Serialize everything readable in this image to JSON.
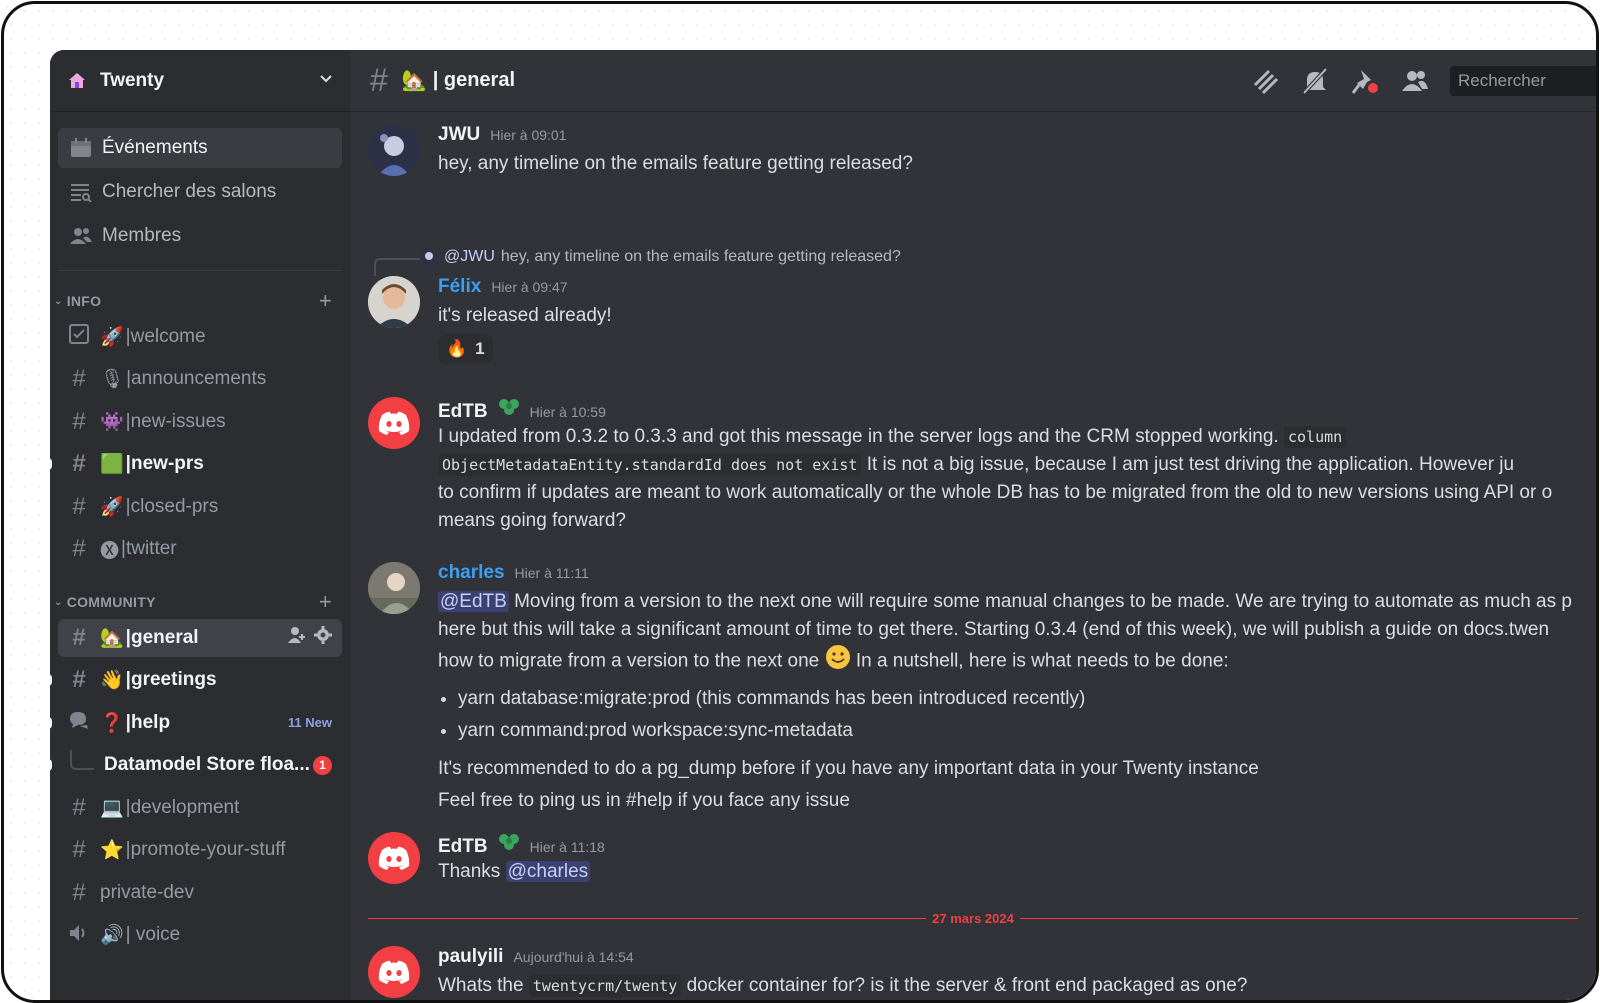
{
  "server": {
    "name": "Twenty"
  },
  "nav": {
    "events": "Événements",
    "browse": "Chercher des salons",
    "members": "Membres"
  },
  "categories": {
    "info": "INFO",
    "community": "COMMUNITY"
  },
  "info_channels": [
    {
      "emoji": "🚀",
      "name": "|welcome"
    },
    {
      "emoji": "🎙",
      "name": "|announcements"
    },
    {
      "emoji": "👾",
      "name": "|new-issues"
    },
    {
      "emoji": "🟩",
      "name": "|new-prs"
    },
    {
      "emoji": "🚀",
      "name": "|closed-prs"
    },
    {
      "emoji": "🅧",
      "name": "|twitter"
    }
  ],
  "community_channels": [
    {
      "emoji": "🏡",
      "name": "|general"
    },
    {
      "emoji": "👋",
      "name": "|greetings"
    },
    {
      "emoji": "❓",
      "name": " |help",
      "new_label": "11 New"
    },
    {
      "emoji": "",
      "name": "Datamodel Store floa...",
      "badge": "1"
    },
    {
      "emoji": "💻",
      "name": "|development"
    },
    {
      "emoji": "⭐",
      "name": "|promote-your-stuff"
    },
    {
      "emoji": "",
      "name": "private-dev"
    },
    {
      "emoji": "🔊",
      "name": " | voice"
    }
  ],
  "header": {
    "emoji": "🏡",
    "title": "| general",
    "search_placeholder": "Rechercher"
  },
  "messages": [
    {
      "author": "JWU",
      "time": "Hier à 09:01",
      "text": "hey, any timeline on the emails feature getting released?"
    },
    {
      "reply_to": "@JWU",
      "reply_text": "hey, any timeline on the emails feature getting released?",
      "author": "Félix",
      "time": "Hier à 09:47",
      "text": "it's released already!",
      "reaction_emoji": "🔥",
      "reaction_count": "1"
    },
    {
      "author": "EdTB",
      "time": "Hier à 10:59",
      "line1": "I updated from 0.3.2 to 0.3.3 and got this message in the server logs and the CRM stopped working.",
      "code1": "column",
      "code2": "ObjectMetadataEntity.standardId does not exist",
      "line2": "It is not a big issue, because I am just test driving the application. However ju",
      "line3": "to confirm if updates are meant to work automatically or the whole DB has to be migrated from the old to new versions using API or o",
      "line4": "means going forward?"
    },
    {
      "author": "charles",
      "time": "Hier à 11:11",
      "mention": "@EdTB",
      "line1": "Moving from a version to the next one will require some manual changes to be made. We are trying to automate as much as p",
      "line2": "here but this will take a significant amount of time to get there. Starting 0.3.4 (end of this week), we will publish a guide on docs.twen",
      "line3a": "how to migrate from a version to the next one",
      "line3b": "In a nutshell, here is what needs to be done:",
      "bullets": [
        "yarn database:migrate:prod (this commands has been introduced recently)",
        "yarn command:prod workspace:sync-metadata"
      ],
      "line4": "It's recommended to do a pg_dump before if you have any important data in your Twenty instance",
      "line5": "Feel free to ping us in #help if you face any issue"
    },
    {
      "author": "EdTB",
      "time": "Hier à 11:18",
      "text": "Thanks",
      "mention": "@charles"
    },
    {
      "author": "paulyili",
      "time": "Aujourd'hui à 14:54",
      "text1": "Whats the",
      "code": "twentycrm/twenty",
      "text2": "docker container for? is it the server & front end packaged as one?"
    }
  ],
  "date_divider": "27 mars 2024",
  "colors": {
    "bg": "#313338",
    "sidebar": "#2b2d31",
    "accent_red": "#f23f43",
    "link_blue": "#3aa0f5"
  }
}
